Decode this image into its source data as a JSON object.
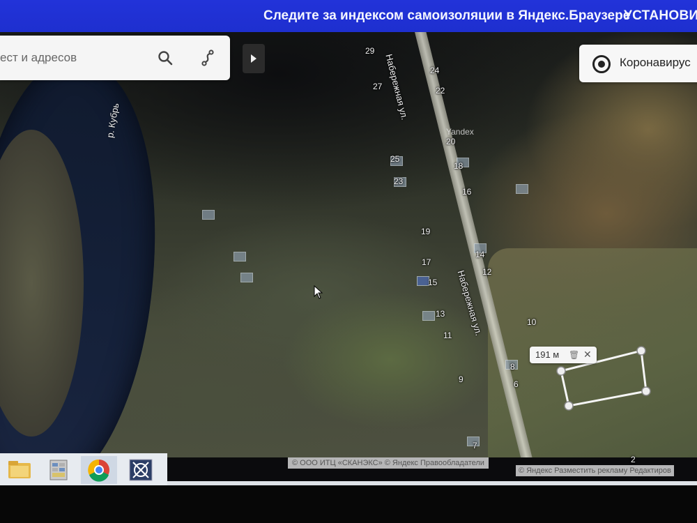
{
  "banner": {
    "message": "Следите за индексом самоизоляции в Яндекс.Браузере",
    "cta": "УСТАНОВИ"
  },
  "search": {
    "placeholder": "ест и адресов"
  },
  "corona_button": {
    "label": "Коронавирус"
  },
  "map": {
    "river_label": "р. Кубрь",
    "street_top": "Набережная ул.",
    "street_mid": "Набережная ул.",
    "watermark": "Yandex",
    "house_numbers": {
      "n29": "29",
      "n24": "24",
      "n27": "27",
      "n22": "22",
      "n20": "20",
      "n25": "25",
      "n18": "18",
      "n23": "23",
      "n16": "16",
      "n19": "19",
      "n14": "14",
      "n17": "17",
      "n12": "12",
      "n15": "15",
      "n13": "13",
      "n10": "10",
      "n11": "11",
      "n8": "8",
      "n6": "6",
      "n9": "9",
      "n7": "7",
      "n2": "2"
    }
  },
  "ruler": {
    "distance": "191 м"
  },
  "copyright": {
    "left": "© ООО ИТЦ «СКАНЭКС» © Яндекс  Правообладатели",
    "right": "© Яндекс   Разместить рекламу   Редактиров"
  },
  "taskbar": {
    "items": [
      "folder-icon",
      "spreadsheet-icon",
      "chrome-icon",
      "app-icon"
    ]
  }
}
